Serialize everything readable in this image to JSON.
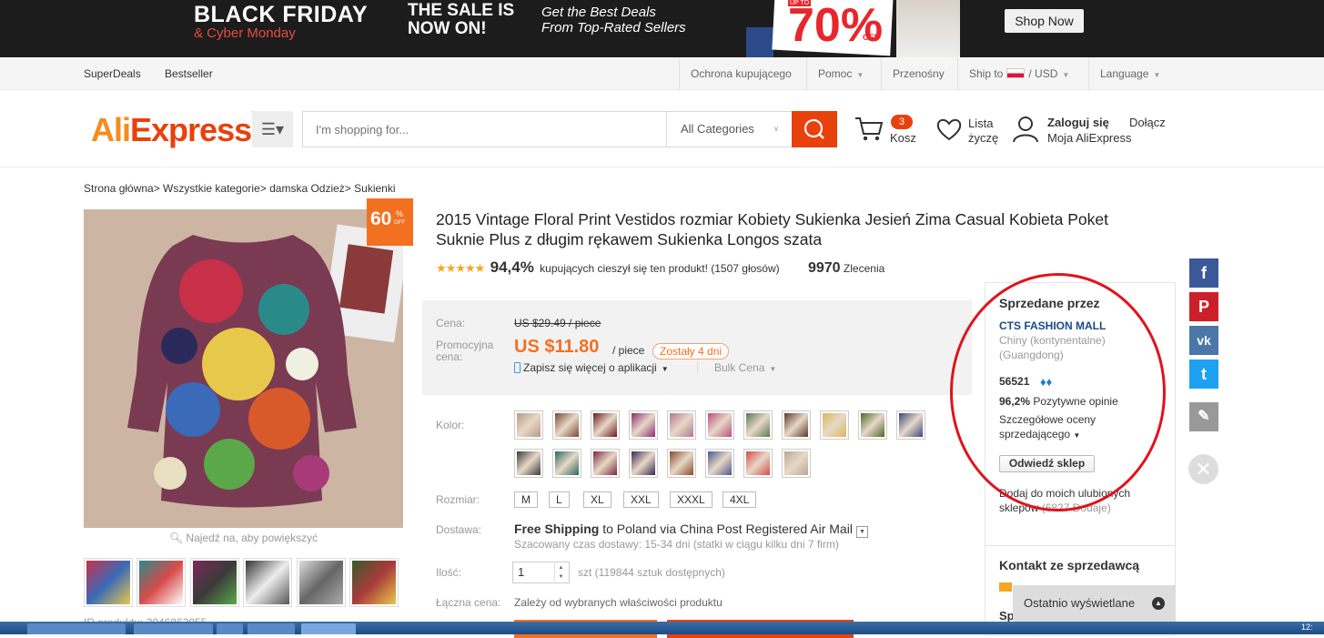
{
  "banner": {
    "line1": "BLACK FRIDAY",
    "line2": "& Cyber Monday",
    "sale": "THE SALE IS NOW ON!",
    "tagline1": "Get the Best Deals",
    "tagline2": "From Top-Rated Sellers",
    "promo_upto": "UP TO",
    "promo_pct": "70%",
    "promo_off": "OFF",
    "cta": "Shop Now"
  },
  "topnav": {
    "left": [
      "SuperDeals",
      "Bestseller"
    ],
    "buyer_protection": "Ochrona kupującego",
    "help": "Pomoc",
    "mobile": "Przenośny",
    "ship_to": "Ship to",
    "currency": "/ USD",
    "language": "Language"
  },
  "header": {
    "logo_a": "Ali",
    "logo_b": "Express",
    "logo_tm": "™",
    "search_placeholder": "I'm shopping for...",
    "category": "All Categories",
    "cart_count": "3",
    "cart_label": "Kosz",
    "wishlist_label": "Lista życzę",
    "signin": "Zaloguj się",
    "join": "Dołącz",
    "my_account": "Moja AliExpress"
  },
  "breadcrumb": "Strona główna> Wszystkie kategorie> damska Odzież> Sukienki",
  "product": {
    "discount_num": "60",
    "discount_pct": "%",
    "discount_off": "OFF",
    "zoom_hint": "Najedź na, aby powiększyć",
    "id_label": "ID produktu: 2046863055",
    "title": "2015 Vintage Floral Print Vestidos rozmiar Kobiety Sukienka Jesień Zima Casual Kobieta Poket Suknie Plus z długim rękawem Sukienka Longos szata",
    "stars": "★★★★★",
    "positive_pct": "94,4%",
    "positive_text": "kupujących cieszył się ten produkt! (1507 głosów)",
    "orders_count": "9970",
    "orders_label": "Zlecenia"
  },
  "price": {
    "price_label": "Cena:",
    "old_price": "US $29.49 / piece",
    "promo_label": "Promocyjna cena:",
    "new_price": "US $11.80",
    "per_piece": "/ piece",
    "days_left": "Zostały 4 dni",
    "app_save": "Zapisz się więcej o aplikacji",
    "bulk": "Bulk Cena"
  },
  "options": {
    "color_label": "Kolor:",
    "swatch_colors": [
      "#b7998a",
      "#7a4a34",
      "#6b1d1d",
      "#8c2d6e",
      "#b07a8a",
      "#b84f7a",
      "#5b7a4f",
      "#5a3a2a",
      "#d8b85a",
      "#4a6a2a",
      "#3a4a7a",
      "#3a3a3a",
      "#2a6a5a",
      "#7a2a3a",
      "#3a2a4a",
      "#8a4a2a",
      "#4a5a8a",
      "#d84a4a",
      "#b8a898"
    ],
    "size_label": "Rozmiar:",
    "sizes": [
      "M",
      "L",
      "XL",
      "XXL",
      "XXXL",
      "4XL"
    ],
    "shipping_label": "Dostawa:",
    "shipping_free": "Free Shipping",
    "shipping_rest": "to Poland via China Post Registered Air Mail",
    "shipping_est": "Szacowany czas dostawy: 15-34 dni (statki w ciągu kilku dni 7 firm)",
    "qty_label": "Ilość:",
    "qty_value": "1",
    "qty_info": "szt (119844 sztuk dostępnych)",
    "total_label": "Łączna cena:",
    "total_value": "Zależy od wybranych właściwości produktu"
  },
  "seller": {
    "heading": "Sprzedane przez",
    "name": "CTS FASHION MALL",
    "location": "Chiny (kontynentalne) (Guangdong)",
    "score": "56521",
    "positive_pct": "96,2%",
    "positive_label": "Pozytywne opinie",
    "detailed": "Szczegółowe oceny sprzedającego",
    "visit_button": "Odwiedź sklep",
    "favorite": "Dodaj do moich ulubionych sklepów",
    "favorite_count": "(6827 Dodaje)",
    "contact_heading": "Kontakt ze sprzedawcą",
    "contact_partial": "Sp"
  },
  "social": [
    "f",
    "P",
    "vk",
    "t",
    "✎"
  ],
  "recently_viewed": "Ostatnio wyświetlane",
  "clock": "12:"
}
